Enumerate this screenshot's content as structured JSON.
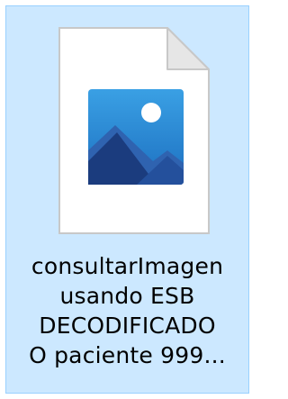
{
  "file": {
    "name_lines": [
      "consultarImagen",
      "usando ESB",
      "DECODIFICADO",
      "O paciente 999..."
    ],
    "icon": "image-file-icon",
    "selected": true
  },
  "colors": {
    "selection_fill": "#cce8ff",
    "selection_border": "#99d1ff",
    "sky": "#2a8fd6",
    "mountain_back": "#2b5fa8",
    "mountain_front": "#1a3a7a",
    "sun": "#ffffff"
  }
}
